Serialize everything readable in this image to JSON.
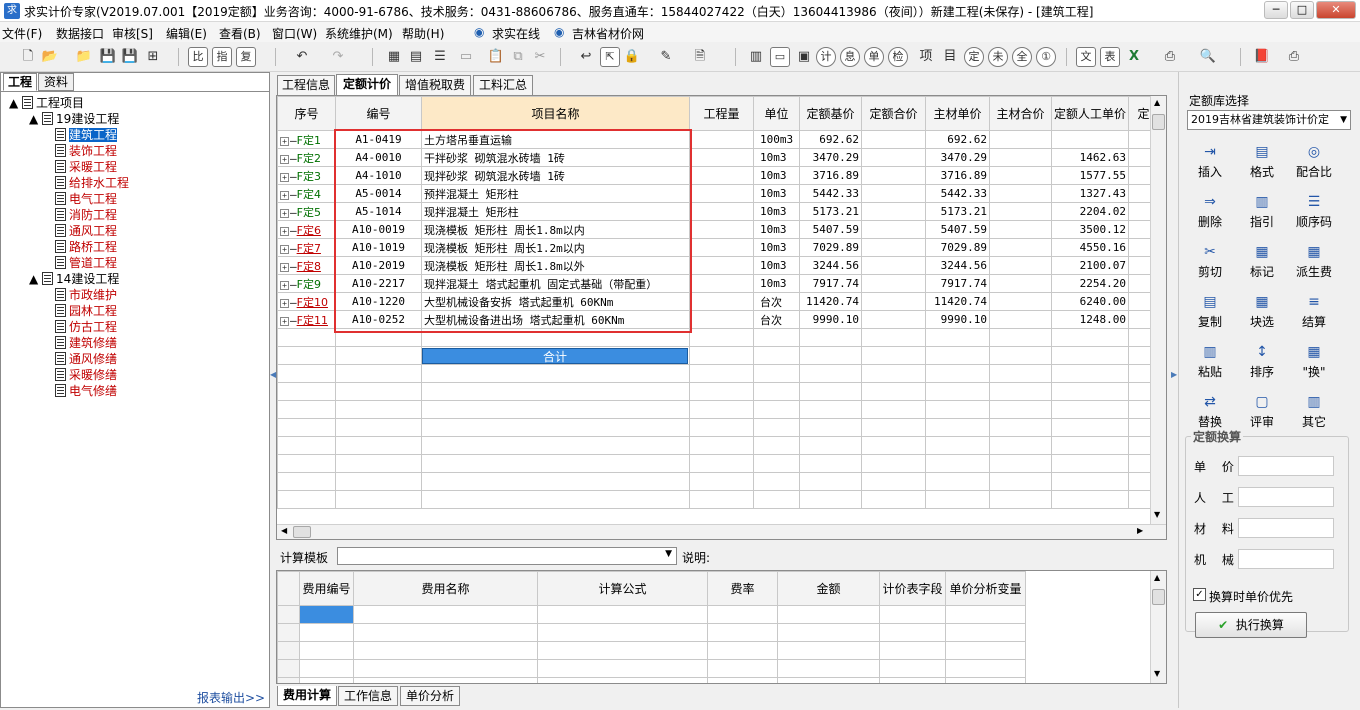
{
  "window": {
    "title": "求实计价专家(V2019.07.001【2019定额】业务咨询：4000-91-6786、技术服务：0431-88606786、服务直通车：15844027422（白天）13604413986（夜间））新建工程(未保存) - [建筑工程]",
    "minimize": "─",
    "maximize": "□",
    "close": "✕"
  },
  "menu": [
    "文件(F)",
    "数据接口",
    "审核[S]",
    "编辑(E)",
    "查看(B)",
    "窗口(W)",
    "系统维护(M)",
    "帮助(H)",
    "求实在线",
    "吉林省材价网"
  ],
  "left": {
    "tabs": [
      "工程",
      "资料"
    ],
    "root": "工程项目",
    "group1": "19建设工程",
    "group1_items": [
      "建筑工程",
      "装饰工程",
      "采暖工程",
      "给排水工程",
      "电气工程",
      "消防工程",
      "通风工程",
      "路桥工程",
      "管道工程"
    ],
    "group2": "14建设工程",
    "group2_items": [
      "市政维护",
      "园林工程",
      "仿古工程",
      "建筑修缮",
      "通风修缮",
      "采暖修缮",
      "电气修缮"
    ],
    "report_link": "报表输出>>"
  },
  "main_tabs": [
    "工程信息",
    "定额计价",
    "增值税取费",
    "工料汇总"
  ],
  "grid": {
    "headers": [
      "序号",
      "编号",
      "项目名称",
      "工程量",
      "单位",
      "定额基价",
      "定额合价",
      "主材单价",
      "主材合价",
      "定额人工单价",
      "定"
    ],
    "rows": [
      {
        "seq": "F定1",
        "code": "A1-0419",
        "name": "土方塔吊垂直运输",
        "qty": "",
        "unit": "100m3",
        "base": "692.62",
        "total": "",
        "mat": "692.62",
        "mattotal": "",
        "labor": "",
        "red": false
      },
      {
        "seq": "F定2",
        "code": "A4-0010",
        "name": "干拌砂浆 砌筑混水砖墙 1砖",
        "qty": "",
        "unit": "10m3",
        "base": "3470.29",
        "total": "",
        "mat": "3470.29",
        "mattotal": "",
        "labor": "1462.63",
        "red": false
      },
      {
        "seq": "F定3",
        "code": "A4-1010",
        "name": "现拌砂浆 砌筑混水砖墙 1砖",
        "qty": "",
        "unit": "10m3",
        "base": "3716.89",
        "total": "",
        "mat": "3716.89",
        "mattotal": "",
        "labor": "1577.55",
        "red": false
      },
      {
        "seq": "F定4",
        "code": "A5-0014",
        "name": "预拌混凝土 矩形柱",
        "qty": "",
        "unit": "10m3",
        "base": "5442.33",
        "total": "",
        "mat": "5442.33",
        "mattotal": "",
        "labor": "1327.43",
        "red": false
      },
      {
        "seq": "F定5",
        "code": "A5-1014",
        "name": "现拌混凝土 矩形柱",
        "qty": "",
        "unit": "10m3",
        "base": "5173.21",
        "total": "",
        "mat": "5173.21",
        "mattotal": "",
        "labor": "2204.02",
        "red": false
      },
      {
        "seq": "F定6",
        "code": "A10-0019",
        "name": "现浇模板 矩形柱 周长1.8m以内",
        "qty": "",
        "unit": "10m3",
        "base": "5407.59",
        "total": "",
        "mat": "5407.59",
        "mattotal": "",
        "labor": "3500.12",
        "red": true
      },
      {
        "seq": "F定7",
        "code": "A10-1019",
        "name": "现浇模板 矩形柱 周长1.2m以内",
        "qty": "",
        "unit": "10m3",
        "base": "7029.89",
        "total": "",
        "mat": "7029.89",
        "mattotal": "",
        "labor": "4550.16",
        "red": true
      },
      {
        "seq": "F定8",
        "code": "A10-2019",
        "name": "现浇模板 矩形柱 周长1.8m以外",
        "qty": "",
        "unit": "10m3",
        "base": "3244.56",
        "total": "",
        "mat": "3244.56",
        "mattotal": "",
        "labor": "2100.07",
        "red": true
      },
      {
        "seq": "F定9",
        "code": "A10-2217",
        "name": "现拌混凝土 塔式起重机 固定式基础（带配重）",
        "qty": "",
        "unit": "10m3",
        "base": "7917.74",
        "total": "",
        "mat": "7917.74",
        "mattotal": "",
        "labor": "2254.20",
        "red": false
      },
      {
        "seq": "F定10",
        "code": "A10-1220",
        "name": "大型机械设备安拆 塔式起重机 60KNm",
        "qty": "",
        "unit": "台次",
        "base": "11420.74",
        "total": "",
        "mat": "11420.74",
        "mattotal": "",
        "labor": "6240.00",
        "red": true
      },
      {
        "seq": "F定11",
        "code": "A10-0252",
        "name": "大型机械设备进出场 塔式起重机 60KNm",
        "qty": "",
        "unit": "台次",
        "base": "9990.10",
        "total": "",
        "mat": "9990.10",
        "mattotal": "",
        "labor": "1248.00",
        "red": true
      }
    ],
    "sum_label": "合计"
  },
  "calc": {
    "template_label": "计算模板",
    "desc_label": "说明:",
    "headers": [
      "费用编号",
      "费用名称",
      "计算公式",
      "费率",
      "金额",
      "计价表字段",
      "单价分析变量"
    ]
  },
  "bottom_tabs": [
    "费用计算",
    "工作信息",
    "单价分析"
  ],
  "right": {
    "lib_label": "定额库选择",
    "lib_value": "2019吉林省建筑装饰计价定",
    "buttons": [
      {
        "label": "插入",
        "icon": "insert-icon"
      },
      {
        "label": "格式",
        "icon": "format-icon"
      },
      {
        "label": "配合比",
        "icon": "mix-ratio-icon"
      },
      {
        "label": "删除",
        "icon": "delete-icon"
      },
      {
        "label": "指引",
        "icon": "guide-icon"
      },
      {
        "label": "顺序码",
        "icon": "sequence-icon"
      },
      {
        "label": "剪切",
        "icon": "cut-icon"
      },
      {
        "label": "标记",
        "icon": "mark-icon"
      },
      {
        "label": "派生费",
        "icon": "derived-fee-icon"
      },
      {
        "label": "复制",
        "icon": "copy-icon"
      },
      {
        "label": "块选",
        "icon": "block-select-icon"
      },
      {
        "label": "结算",
        "icon": "settle-icon"
      },
      {
        "label": "粘贴",
        "icon": "paste-icon"
      },
      {
        "label": "排序",
        "icon": "sort-icon"
      },
      {
        "label": "\"换\"",
        "icon": "replace-mark-icon"
      },
      {
        "label": "替换",
        "icon": "replace-icon"
      },
      {
        "label": "评审",
        "icon": "review-icon"
      },
      {
        "label": "其它",
        "icon": "other-icon"
      }
    ],
    "convert_title": "定额换算",
    "convert_fields": [
      "单 价",
      "人 工",
      "材 料",
      "机 械"
    ],
    "checkbox_label": "换算时单价优先",
    "execute_label": "执行换算"
  }
}
